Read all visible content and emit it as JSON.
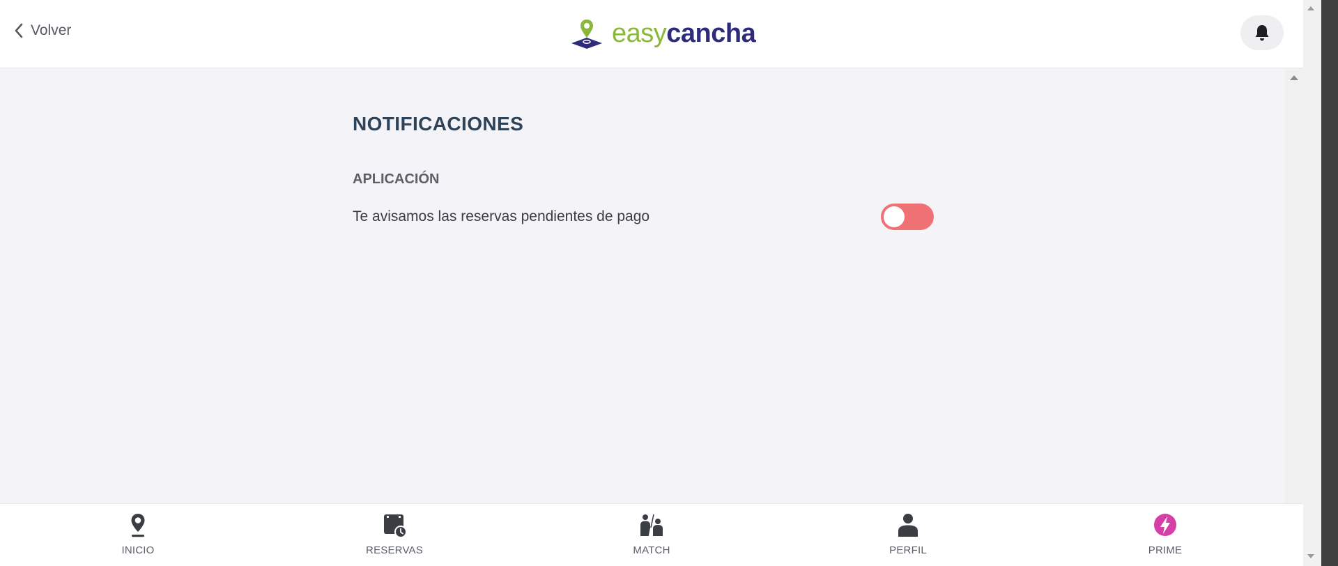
{
  "header": {
    "back_label": "Volver",
    "logo": {
      "part1": "easy",
      "part2": "cancha"
    },
    "notification_icon": "bell-icon"
  },
  "main": {
    "title": "NOTIFICACIONES",
    "section_title": "APLICACIÓN",
    "settings": [
      {
        "label": "Te avisamos las reservas pendientes de pago",
        "enabled": false
      }
    ]
  },
  "bottom_nav": {
    "items": [
      {
        "label": "INICIO",
        "icon": "location-pin-icon"
      },
      {
        "label": "RESERVAS",
        "icon": "calendar-clock-icon"
      },
      {
        "label": "MATCH",
        "icon": "match-players-icon"
      },
      {
        "label": "PERFIL",
        "icon": "person-icon"
      },
      {
        "label": "PRIME",
        "icon": "lightning-badge-icon"
      }
    ]
  },
  "colors": {
    "brand_green": "#8bb83b",
    "brand_navy": "#2e2c7a",
    "toggle_off": "#f07173",
    "prime_accent": "#d63fa8",
    "title": "#2e4358"
  }
}
